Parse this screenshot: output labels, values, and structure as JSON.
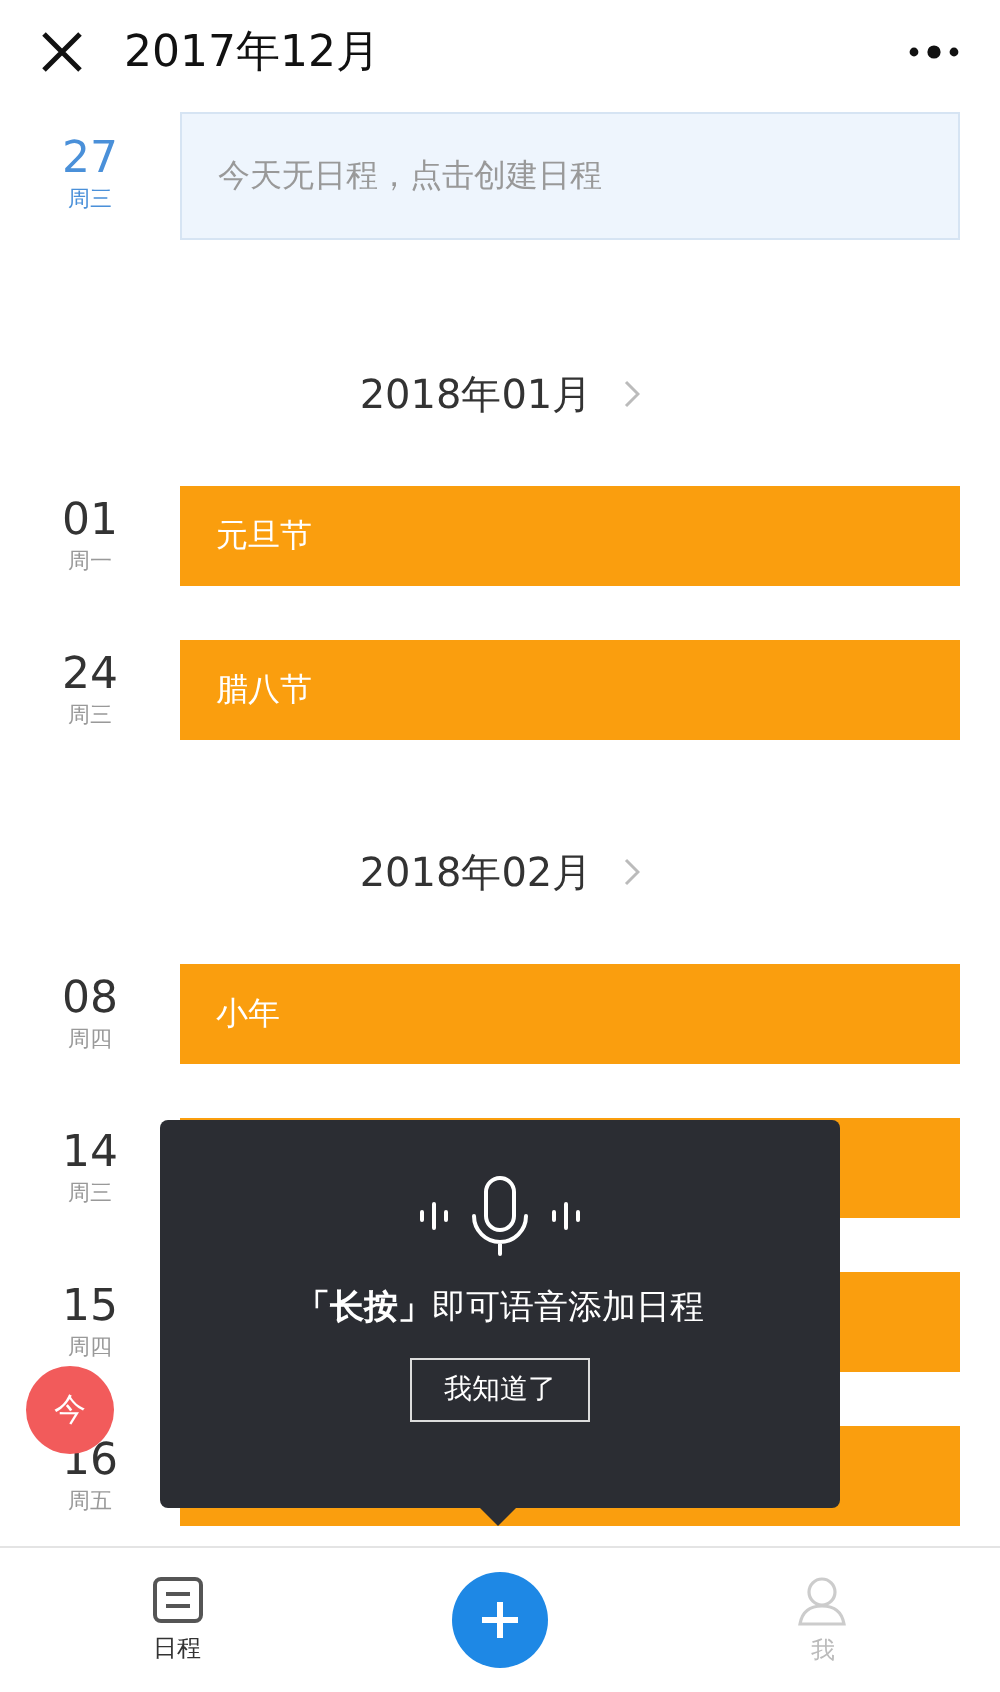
{
  "header": {
    "title": "2017年12月"
  },
  "sections": [
    {
      "days": [
        {
          "day": "27",
          "weekday": "周三",
          "today": true,
          "kind": "empty",
          "text": "今天无日程，点击创建日程"
        }
      ]
    },
    {
      "month": "2018年01月",
      "days": [
        {
          "day": "01",
          "weekday": "周一",
          "today": false,
          "kind": "event",
          "text": "元旦节"
        },
        {
          "day": "24",
          "weekday": "周三",
          "today": false,
          "kind": "event",
          "text": "腊八节"
        }
      ]
    },
    {
      "month": "2018年02月",
      "days": [
        {
          "day": "08",
          "weekday": "周四",
          "today": false,
          "kind": "event",
          "text": "小年"
        },
        {
          "day": "14",
          "weekday": "周三",
          "today": false,
          "kind": "event"
        },
        {
          "day": "15",
          "weekday": "周四",
          "today": false,
          "kind": "event"
        },
        {
          "day": "16",
          "weekday": "周五",
          "today": false,
          "kind": "event"
        }
      ]
    }
  ],
  "today_button": "今",
  "tip": {
    "before": "「长按」",
    "after": "即可语音添加日程",
    "button": "我知道了"
  },
  "tabs": [
    {
      "label": "日程",
      "selected": true
    },
    {
      "label": "我",
      "selected": false
    }
  ]
}
